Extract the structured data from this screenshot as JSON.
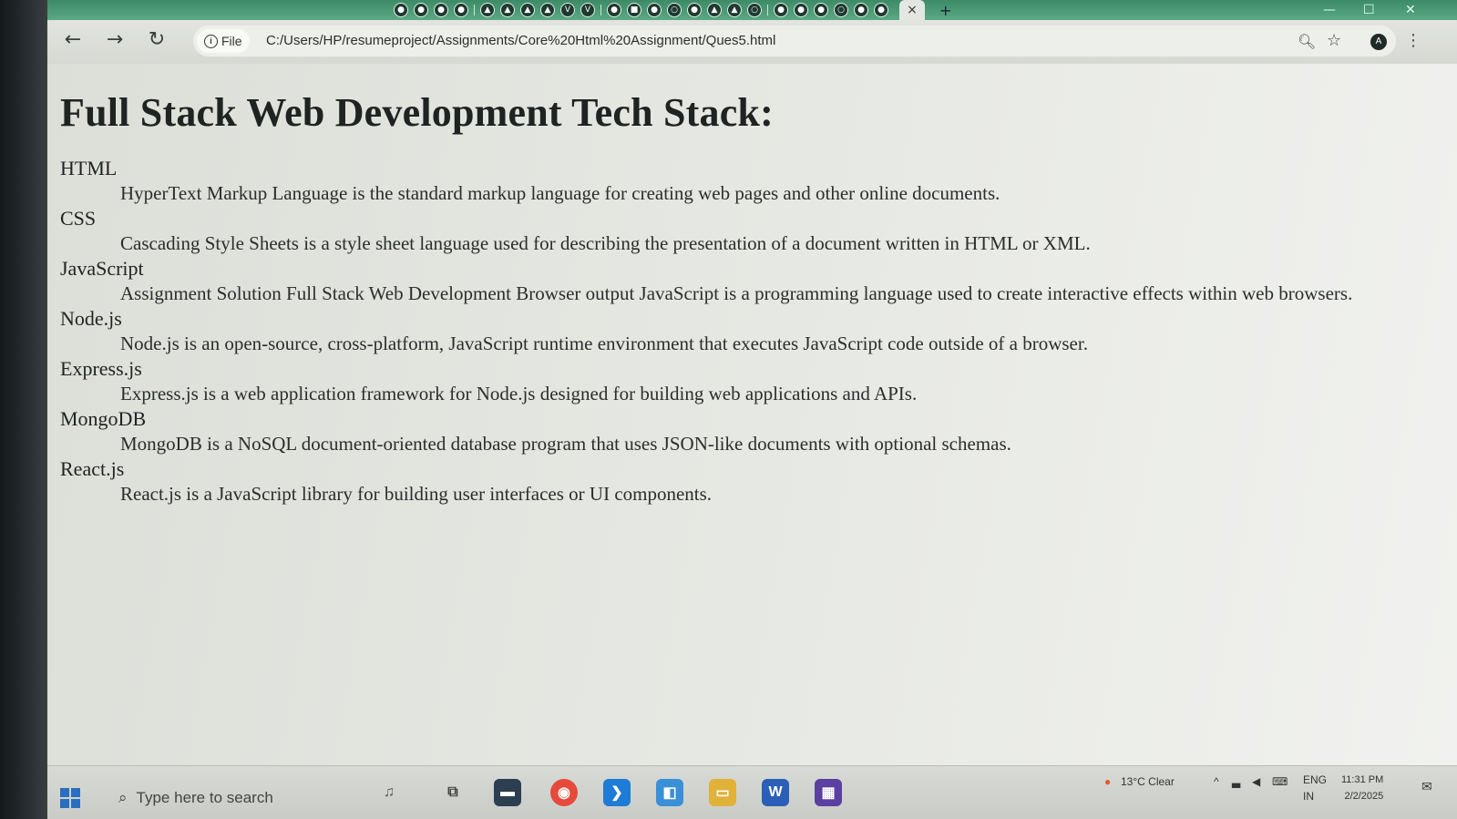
{
  "browser": {
    "tab_active_close": "×",
    "new_tab": "+",
    "file_chip_label": "File",
    "url": "C:/Users/HP/resumeproject/Assignments/Core%20Html%20Assignment/Ques5.html"
  },
  "page": {
    "title": "Full Stack Web Development Tech Stack:",
    "terms": [
      {
        "term": "HTML",
        "definition": "HyperText Markup Language is the standard markup language for creating web pages and other online documents."
      },
      {
        "term": "CSS",
        "definition": "Cascading Style Sheets is a style sheet language used for describing the presentation of a document written in HTML or XML."
      },
      {
        "term": "JavaScript",
        "definition": "Assignment Solution Full Stack Web Development Browser output JavaScript is a programming language used to create interactive effects within web browsers."
      },
      {
        "term": "Node.js",
        "definition": "Node.js is an open-source, cross-platform, JavaScript runtime environment that executes JavaScript code outside of a browser."
      },
      {
        "term": "Express.js",
        "definition": "Express.js is a web application framework for Node.js designed for building web applications and APIs."
      },
      {
        "term": "MongoDB",
        "definition": "MongoDB is a NoSQL document-oriented database program that uses JSON-like documents with optional schemas."
      },
      {
        "term": "React.js",
        "definition": "React.js is a JavaScript library for building user interfaces or UI components."
      }
    ]
  },
  "taskbar": {
    "search_placeholder": "Type here to search",
    "weather": "13°C Clear",
    "language": "ENG",
    "region": "IN",
    "time": "11:31 PM",
    "date": "2/2/2025"
  },
  "icons": {
    "back": "back-arrow-icon",
    "forward": "forward-arrow-icon",
    "reload": "reload-icon",
    "zoom": "zoom-icon",
    "bookmark": "star-icon",
    "menu": "kebab-menu-icon",
    "windows": "windows-logo-icon",
    "search": "search-icon"
  },
  "colors": {
    "tab_strip": "#4a9a75",
    "page_background": "#e6e8e3",
    "text": "#1f2321"
  }
}
